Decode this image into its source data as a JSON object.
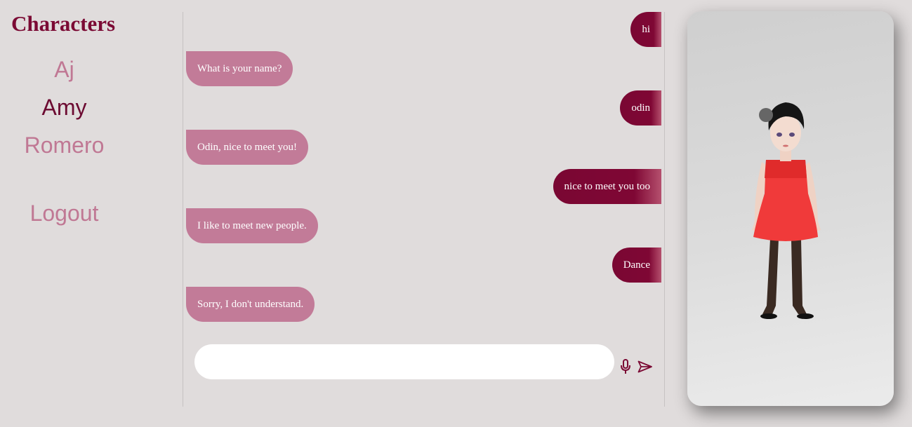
{
  "sidebar": {
    "title": "Characters",
    "characters": [
      {
        "label": "Aj"
      },
      {
        "label": "Amy"
      },
      {
        "label": "Romero"
      }
    ],
    "logout_label": "Logout"
  },
  "chat": {
    "messages": [
      {
        "from": "user",
        "text": "hi"
      },
      {
        "from": "bot",
        "text": "What is your name?"
      },
      {
        "from": "user",
        "text": "odin"
      },
      {
        "from": "bot",
        "text": "Odin, nice to meet you!"
      },
      {
        "from": "user",
        "text": "nice to meet you too"
      },
      {
        "from": "bot",
        "text": "I like to meet new people."
      },
      {
        "from": "user",
        "text": "Dance"
      },
      {
        "from": "bot",
        "text": "Sorry, I don't understand."
      }
    ],
    "input_value": "",
    "input_placeholder": ""
  },
  "icons": {
    "mic": "microphone-icon",
    "send": "send-icon"
  },
  "colors": {
    "accent": "#7b0a34",
    "bot_bubble": "#c27b98",
    "inactive_link": "#c07894",
    "background": "#e0dcdc"
  }
}
